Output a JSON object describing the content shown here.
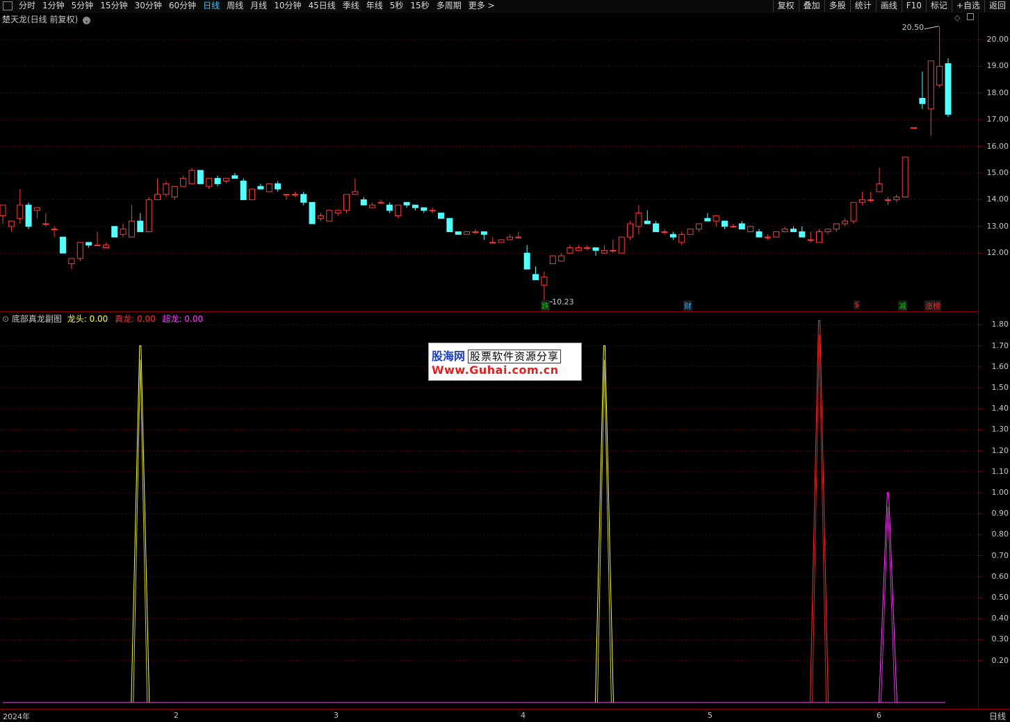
{
  "toolbar": {
    "periods": [
      "分时",
      "1分钟",
      "5分钟",
      "15分钟",
      "30分钟",
      "60分钟",
      "日线",
      "周线",
      "月线",
      "10分钟",
      "45日线",
      "季线",
      "年线",
      "5秒",
      "15秒",
      "多周期",
      "更多 >"
    ],
    "active_period": "日线",
    "right": [
      "复权",
      "叠加",
      "多股",
      "统计",
      "画线",
      "F10",
      "标记",
      "+自选",
      "返回"
    ]
  },
  "main_panel": {
    "title": "楚天龙(日线 前复权)",
    "high_label": "20.50",
    "low_label": "10.23",
    "y_ticks": [
      "20.00",
      "19.00",
      "18.00",
      "17.00",
      "16.00",
      "15.00",
      "14.00",
      "13.00",
      "12.00"
    ],
    "markers": [
      {
        "text": "跌",
        "color": "#10c010"
      },
      {
        "text": "财",
        "color": "#39a8ff"
      },
      {
        "text": "$",
        "color": "#e03030"
      },
      {
        "text": "减",
        "color": "#10c010"
      },
      {
        "text": "涨榜",
        "color": "#e03030"
      }
    ],
    "up_color": "#ff3c3c",
    "down_color": "#54ffff"
  },
  "sub_panel": {
    "title": "底部真龙副图",
    "indicators": [
      {
        "name": "龙头",
        "value": "0.00",
        "color": "#ffff40"
      },
      {
        "name": "真龙",
        "value": "0.00",
        "color": "#ff3030"
      },
      {
        "name": "超龙",
        "value": "0.00",
        "color": "#ff40ff"
      }
    ],
    "y_ticks": [
      "1.80",
      "1.70",
      "1.60",
      "1.50",
      "1.40",
      "1.30",
      "1.20",
      "1.10",
      "1.00",
      "0.90",
      "0.80",
      "0.70",
      "0.60",
      "0.50",
      "0.40",
      "0.30",
      "0.20"
    ]
  },
  "x_axis": {
    "labels": [
      "2024年",
      "2",
      "3",
      "4",
      "5",
      "6"
    ],
    "period_label": "日线"
  },
  "watermark": {
    "logo": "股海网",
    "slogan": "股票软件资源分享",
    "url": "Www.Guhai.com.cn"
  },
  "chart_data": [
    {
      "type": "candlestick",
      "title": "楚天龙(日线 前复权)",
      "ylim": [
        11.2,
        20.6
      ],
      "candles": [
        [
          13.4,
          13.8,
          13.1,
          13.8
        ],
        [
          13.0,
          13.2,
          12.8,
          13.2
        ],
        [
          13.3,
          14.4,
          13.1,
          13.8
        ],
        [
          13.8,
          13.9,
          12.9,
          13.0
        ],
        [
          13.6,
          13.7,
          13.3,
          13.7
        ],
        [
          13.1,
          13.5,
          13.0,
          13.1
        ],
        [
          12.9,
          13.0,
          12.6,
          12.9
        ],
        [
          12.6,
          12.6,
          12.0,
          12.0
        ],
        [
          11.6,
          11.8,
          11.4,
          11.8
        ],
        [
          11.8,
          12.4,
          11.7,
          12.4
        ],
        [
          12.4,
          12.4,
          12.2,
          12.3
        ],
        [
          12.3,
          12.8,
          12.3,
          12.3
        ],
        [
          12.2,
          12.4,
          12.2,
          12.3
        ],
        [
          13.0,
          13.0,
          12.6,
          12.6
        ],
        [
          12.7,
          13.1,
          12.6,
          12.9
        ],
        [
          12.6,
          13.8,
          12.6,
          13.2
        ],
        [
          13.2,
          13.5,
          13.2,
          12.8
        ],
        [
          12.8,
          14.1,
          12.8,
          14.0
        ],
        [
          14.0,
          14.8,
          14.0,
          14.2
        ],
        [
          14.2,
          14.7,
          14.1,
          14.6
        ],
        [
          14.1,
          14.5,
          14.0,
          14.5
        ],
        [
          14.5,
          14.9,
          14.5,
          14.8
        ],
        [
          14.6,
          15.2,
          14.6,
          15.1
        ],
        [
          15.1,
          15.1,
          14.6,
          14.6
        ],
        [
          14.5,
          14.8,
          14.4,
          14.8
        ],
        [
          14.8,
          14.9,
          14.5,
          14.6
        ],
        [
          14.7,
          14.8,
          14.6,
          14.8
        ],
        [
          14.9,
          15.0,
          14.8,
          14.8
        ],
        [
          14.7,
          14.8,
          14.0,
          14.0
        ],
        [
          14.0,
          14.4,
          14.0,
          14.4
        ],
        [
          14.5,
          14.6,
          14.4,
          14.4
        ],
        [
          14.3,
          14.6,
          14.3,
          14.6
        ],
        [
          14.6,
          14.7,
          14.3,
          14.4
        ],
        [
          14.2,
          14.2,
          14.0,
          14.2
        ],
        [
          14.2,
          14.3,
          14.1,
          14.2
        ],
        [
          14.2,
          14.3,
          13.8,
          13.9
        ],
        [
          13.9,
          13.9,
          13.1,
          13.1
        ],
        [
          13.3,
          13.5,
          13.2,
          13.4
        ],
        [
          13.2,
          13.6,
          13.2,
          13.6
        ],
        [
          13.5,
          13.6,
          13.4,
          13.6
        ],
        [
          13.6,
          14.2,
          13.5,
          14.2
        ],
        [
          14.2,
          14.8,
          14.2,
          14.3
        ],
        [
          14.0,
          14.1,
          13.8,
          13.8
        ],
        [
          13.7,
          13.9,
          13.7,
          13.8
        ],
        [
          13.9,
          14.0,
          13.9,
          13.9
        ],
        [
          13.8,
          13.9,
          13.5,
          13.6
        ],
        [
          13.4,
          13.8,
          13.3,
          13.8
        ],
        [
          13.9,
          13.9,
          13.7,
          13.8
        ],
        [
          13.8,
          13.8,
          13.6,
          13.7
        ],
        [
          13.7,
          13.7,
          13.5,
          13.6
        ],
        [
          13.6,
          13.7,
          13.5,
          13.6
        ],
        [
          13.5,
          13.5,
          13.3,
          13.3
        ],
        [
          13.3,
          13.3,
          12.8,
          12.8
        ],
        [
          12.8,
          12.8,
          12.7,
          12.7
        ],
        [
          12.7,
          12.8,
          12.7,
          12.8
        ],
        [
          12.8,
          12.9,
          12.7,
          12.8
        ],
        [
          12.8,
          12.8,
          12.5,
          12.7
        ],
        [
          12.4,
          12.6,
          12.4,
          12.4
        ],
        [
          12.4,
          12.5,
          12.4,
          12.5
        ],
        [
          12.5,
          12.7,
          12.5,
          12.6
        ],
        [
          12.6,
          12.8,
          12.6,
          12.6
        ],
        [
          12.0,
          12.3,
          11.4,
          11.4
        ],
        [
          11.2,
          11.5,
          11.0,
          11.0
        ],
        [
          10.8,
          11.3,
          10.2,
          11.1
        ],
        [
          11.6,
          11.9,
          11.6,
          11.9
        ],
        [
          11.7,
          12.0,
          11.7,
          11.9
        ],
        [
          12.0,
          12.3,
          12.0,
          12.2
        ],
        [
          12.1,
          12.3,
          12.1,
          12.2
        ],
        [
          12.2,
          12.3,
          12.1,
          12.2
        ],
        [
          12.2,
          12.2,
          11.9,
          12.1
        ],
        [
          12.0,
          12.3,
          12.0,
          12.1
        ],
        [
          12.1,
          12.5,
          12.0,
          12.1
        ],
        [
          12.0,
          12.6,
          12.0,
          12.6
        ],
        [
          12.6,
          13.2,
          12.5,
          13.1
        ],
        [
          13.0,
          13.8,
          12.7,
          13.5
        ],
        [
          13.2,
          13.6,
          13.1,
          13.1
        ],
        [
          13.1,
          13.2,
          12.8,
          12.8
        ],
        [
          12.8,
          12.9,
          12.7,
          12.8
        ],
        [
          12.7,
          12.8,
          12.5,
          12.6
        ],
        [
          12.4,
          12.8,
          12.3,
          12.7
        ],
        [
          12.7,
          12.9,
          12.7,
          12.9
        ],
        [
          12.9,
          13.1,
          12.8,
          13.1
        ],
        [
          13.3,
          13.5,
          13.2,
          13.2
        ],
        [
          13.2,
          13.4,
          13.0,
          13.4
        ],
        [
          13.2,
          13.2,
          12.9,
          13.0
        ],
        [
          13.0,
          13.1,
          13.0,
          13.0
        ],
        [
          13.1,
          13.2,
          12.9,
          12.9
        ],
        [
          12.8,
          13.0,
          12.8,
          13.0
        ],
        [
          12.8,
          12.9,
          12.6,
          12.6
        ],
        [
          12.6,
          12.7,
          12.5,
          12.6
        ],
        [
          12.6,
          12.8,
          12.6,
          12.8
        ],
        [
          12.8,
          13.0,
          12.8,
          12.9
        ],
        [
          12.9,
          13.0,
          12.8,
          12.8
        ],
        [
          12.8,
          13.0,
          12.6,
          12.6
        ],
        [
          12.5,
          12.8,
          12.4,
          12.5
        ],
        [
          12.4,
          12.9,
          12.4,
          12.8
        ],
        [
          12.8,
          12.9,
          12.7,
          12.9
        ],
        [
          12.9,
          13.1,
          12.8,
          13.1
        ],
        [
          13.1,
          13.3,
          13.0,
          13.2
        ],
        [
          13.2,
          13.9,
          13.1,
          13.9
        ],
        [
          13.9,
          14.3,
          13.8,
          14.0
        ],
        [
          14.0,
          14.3,
          13.9,
          14.0
        ],
        [
          14.3,
          15.2,
          14.3,
          14.6
        ],
        [
          14.0,
          14.1,
          13.8,
          14.0
        ],
        [
          14.0,
          14.2,
          13.9,
          14.1
        ],
        [
          14.1,
          15.6,
          14.1,
          15.6
        ],
        [
          16.7,
          16.7,
          16.7,
          16.7
        ],
        [
          17.8,
          18.8,
          17.4,
          17.6
        ],
        [
          17.4,
          19.2,
          16.4,
          19.2
        ],
        [
          18.3,
          20.5,
          18.2,
          19.0
        ],
        [
          19.1,
          19.3,
          17.1,
          17.2
        ]
      ]
    },
    {
      "type": "line",
      "title": "底部真龙副图",
      "ylim": [
        0,
        1.85
      ],
      "series": [
        {
          "name": "龙头",
          "color": "#ffff40",
          "peaks": [
            [
              16,
              1.7
            ],
            [
              70,
              1.7
            ]
          ]
        },
        {
          "name": "真龙",
          "color": "#ff3030",
          "peaks": [
            [
              95,
              1.82
            ]
          ]
        },
        {
          "name": "超龙",
          "color": "#ff40ff",
          "peaks": [
            [
              103,
              1.0
            ]
          ]
        }
      ]
    }
  ]
}
